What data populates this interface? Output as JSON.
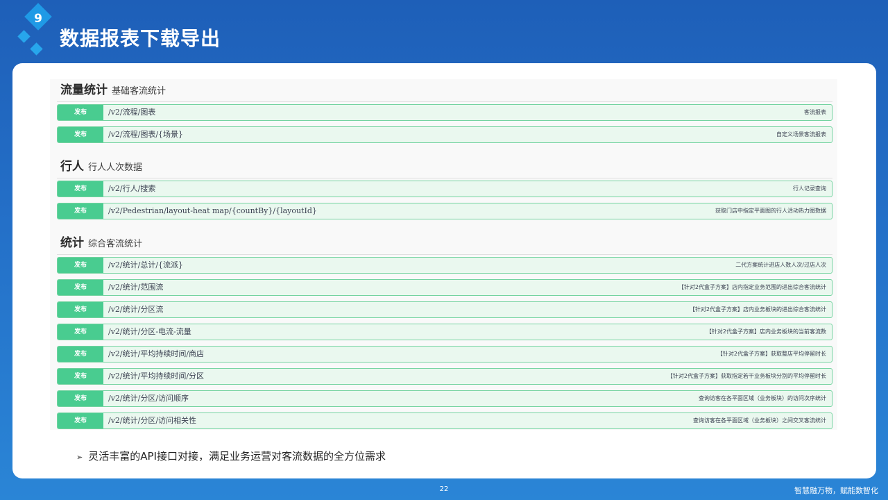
{
  "slide": {
    "number": "9",
    "title": "数据报表下载导出",
    "bullet": "灵活丰富的API接口对接，满足业务运营对客流数据的全方位需求",
    "page": "22",
    "slogan": "智慧融万物，赋能数智化"
  },
  "sections": [
    {
      "name": "流量统计",
      "desc": "基础客流统计",
      "endpoints": [
        {
          "method": "发布",
          "path": "/v2/流程/图表",
          "summary": "客流报表"
        },
        {
          "method": "发布",
          "path": "/v2/流程/图表/{场景}",
          "summary": "自定义场景客流报表"
        }
      ]
    },
    {
      "name": "行人",
      "desc": "行人人次数据",
      "endpoints": [
        {
          "method": "发布",
          "path": "/v2/行人/搜索",
          "summary": "行人记录查询"
        },
        {
          "method": "发布",
          "path": "/v2/Pedestrian/layout-heat map/{countBy}/{layoutId}",
          "summary": "获取门店中指定平面图的行人活动热力图数据"
        }
      ]
    },
    {
      "name": "统计",
      "desc": "综合客流统计",
      "endpoints": [
        {
          "method": "发布",
          "path": "/v2/统计/总计/{流派}",
          "summary": "二代方案统计进店人数人次/过店人次"
        },
        {
          "method": "发布",
          "path": "/v2/统计/范围流",
          "summary": "【针对2代盒子方案】店内指定业务范围的进出综合客流统计"
        },
        {
          "method": "发布",
          "path": "/v2/统计/分区流",
          "summary": "【针对2代盒子方案】店内业务板块的进出综合客流统计"
        },
        {
          "method": "发布",
          "path": "/v2/统计/分区-电流-流量",
          "summary": "【针对2代盒子方案】店内业务板块的当前客流数"
        },
        {
          "method": "发布",
          "path": "/v2/统计/平均持续时间/商店",
          "summary": "【针对2代盒子方案】获取整店平均停留时长"
        },
        {
          "method": "发布",
          "path": "/v2/统计/平均持续时间/分区",
          "summary": "【针对2代盒子方案】获取指定若干业务板块分别的平均停留时长"
        },
        {
          "method": "发布",
          "path": "/v2/统计/分区/访问顺序",
          "summary": "查询访客在各平面区域（业务板块）的访问次序统计"
        },
        {
          "method": "发布",
          "path": "/v2/统计/分区/访问相关性",
          "summary": "查询访客在各平面区域（业务板块）之间交叉客流统计"
        }
      ]
    }
  ]
}
